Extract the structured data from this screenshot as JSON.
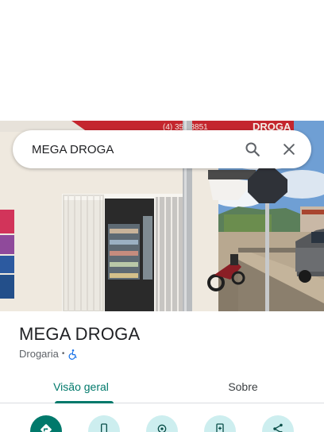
{
  "search": {
    "query": "MEGA DROGA"
  },
  "photo": {
    "sign_text": "DROGA",
    "phone_text": "(4) 353 3851"
  },
  "place": {
    "name": "MEGA DROGA",
    "category": "Drogaria",
    "separator": "•"
  },
  "tabs": [
    {
      "label": "Visão geral",
      "active": true
    },
    {
      "label": "Sobre",
      "active": false
    }
  ],
  "actions": [
    {
      "icon": "directions-icon"
    },
    {
      "icon": "phone-icon"
    },
    {
      "icon": "location-icon"
    },
    {
      "icon": "save-icon"
    },
    {
      "icon": "share-icon"
    }
  ],
  "colors": {
    "accent": "#00796b",
    "action_secondary": "#cdeeef",
    "wheelchair": "#1a73e8"
  }
}
